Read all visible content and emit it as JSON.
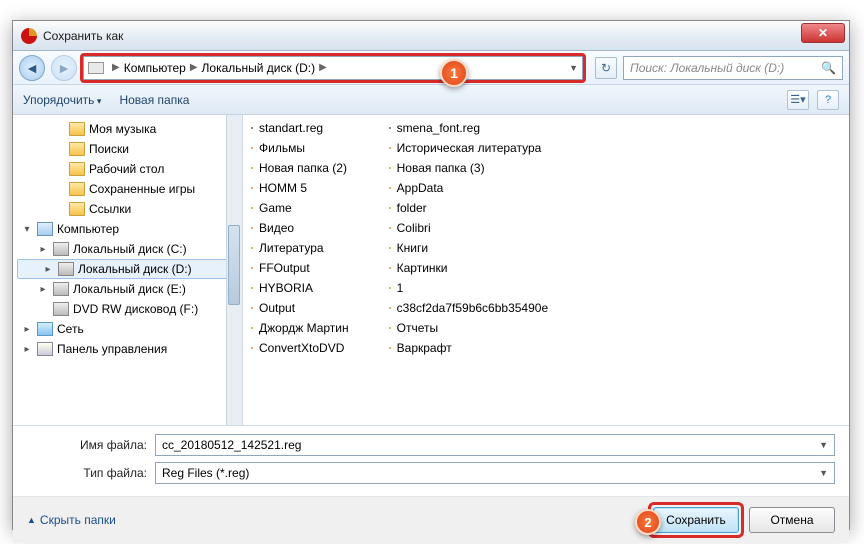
{
  "window": {
    "title": "Сохранить как",
    "close": "✕"
  },
  "nav": {
    "back": "◄",
    "fwd": "►",
    "refresh": "↻",
    "crumbs": [
      "Компьютер",
      "Локальный диск (D:)"
    ],
    "search_placeholder": "Поиск: Локальный диск (D:)"
  },
  "callouts": {
    "one": "1",
    "two": "2"
  },
  "toolbar": {
    "organize": "Упорядочить",
    "newfolder": "Новая папка"
  },
  "sidebar": {
    "items": [
      {
        "label": "Моя музыка",
        "icon": "ic-folder",
        "indent": 2,
        "exp": ""
      },
      {
        "label": "Поиски",
        "icon": "ic-folder",
        "indent": 2,
        "exp": ""
      },
      {
        "label": "Рабочий стол",
        "icon": "ic-folder",
        "indent": 2,
        "exp": ""
      },
      {
        "label": "Сохраненные игры",
        "icon": "ic-folder",
        "indent": 2,
        "exp": ""
      },
      {
        "label": "Ссылки",
        "icon": "ic-folder",
        "indent": 2,
        "exp": ""
      },
      {
        "label": "Компьютер",
        "icon": "ic-comp",
        "indent": 0,
        "exp": "▾"
      },
      {
        "label": "Локальный диск (C:)",
        "icon": "ic-drive",
        "indent": 1,
        "exp": "▸"
      },
      {
        "label": "Локальный диск (D:)",
        "icon": "ic-drive",
        "indent": 1,
        "exp": "▸",
        "sel": true
      },
      {
        "label": "Локальный диск (E:)",
        "icon": "ic-drive",
        "indent": 1,
        "exp": "▸"
      },
      {
        "label": "DVD RW дисковод (F:)",
        "icon": "ic-drive",
        "indent": 1,
        "exp": ""
      },
      {
        "label": "Сеть",
        "icon": "ic-net",
        "indent": 0,
        "exp": "▸"
      },
      {
        "label": "Панель управления",
        "icon": "ic-panel",
        "indent": 0,
        "exp": "▸"
      }
    ]
  },
  "files": {
    "col1": [
      {
        "label": "standart.reg",
        "icon": "ic-reg"
      },
      {
        "label": "Фильмы",
        "icon": "ic-folder"
      },
      {
        "label": "Новая папка (2)",
        "icon": "ic-folder"
      },
      {
        "label": "HOMM 5",
        "icon": "ic-folder"
      },
      {
        "label": "Game",
        "icon": "ic-folder"
      },
      {
        "label": "Видео",
        "icon": "ic-folder"
      },
      {
        "label": "Литература",
        "icon": "ic-folder"
      },
      {
        "label": "FFOutput",
        "icon": "ic-folder"
      },
      {
        "label": "HYBORIA",
        "icon": "ic-folder"
      },
      {
        "label": "Output",
        "icon": "ic-folder"
      },
      {
        "label": "Джордж Мартин",
        "icon": "ic-folder"
      },
      {
        "label": "ConvertXtoDVD",
        "icon": "ic-folder"
      }
    ],
    "col2": [
      {
        "label": "smena_font.reg",
        "icon": "ic-reg"
      },
      {
        "label": "Историческая литература",
        "icon": "ic-folder"
      },
      {
        "label": "Новая папка (3)",
        "icon": "ic-folder"
      },
      {
        "label": "AppData",
        "icon": "ic-folder"
      },
      {
        "label": "folder",
        "icon": "ic-folder"
      },
      {
        "label": "Colibri",
        "icon": "ic-folder"
      },
      {
        "label": "Книги",
        "icon": "ic-folder"
      },
      {
        "label": "Картинки",
        "icon": "ic-folder"
      },
      {
        "label": "1",
        "icon": "ic-folder"
      },
      {
        "label": "c38cf2da7f59b6c6bb35490e",
        "icon": "ic-folder"
      },
      {
        "label": "Отчеты",
        "icon": "ic-folder"
      },
      {
        "label": "Варкрафт",
        "icon": "ic-folder"
      }
    ]
  },
  "bottom": {
    "filename_label": "Имя файла:",
    "filename_value": "cc_20180512_142521.reg",
    "filetype_label": "Тип файла:",
    "filetype_value": "Reg Files (*.reg)"
  },
  "footer": {
    "hidefolders": "Скрыть папки",
    "save": "Сохранить",
    "cancel": "Отмена"
  }
}
